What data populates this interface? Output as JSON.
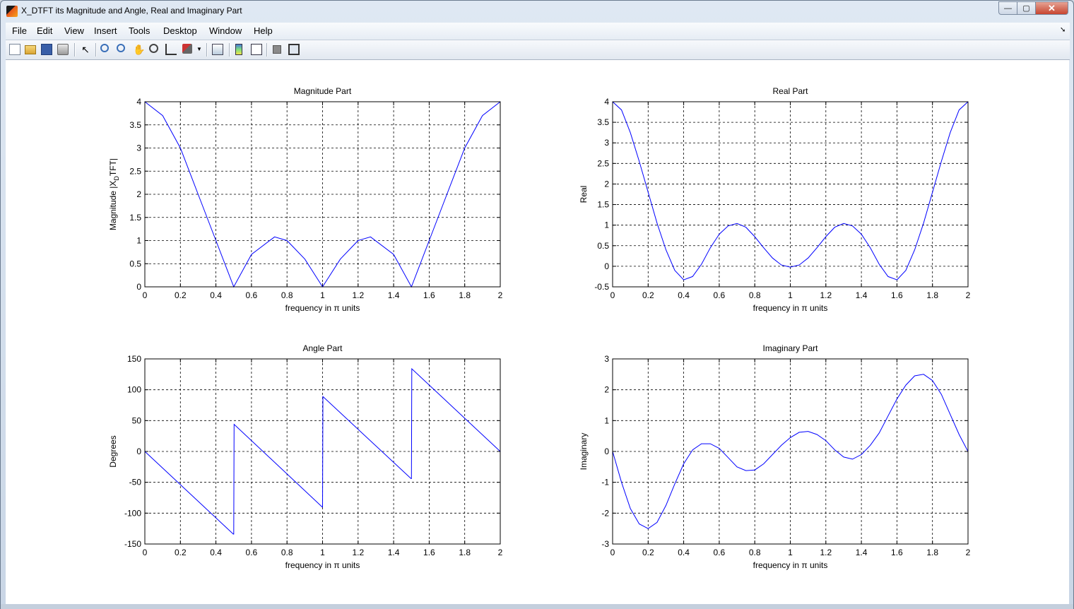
{
  "window": {
    "title": "X_DTFT its Magnitude and Angle, Real and Imaginary Part",
    "controls": {
      "minimize": "—",
      "maximize": "▢",
      "close": "✕"
    }
  },
  "menu": [
    "File",
    "Edit",
    "View",
    "Insert",
    "Tools",
    "Desktop",
    "Window",
    "Help"
  ],
  "menu_overflow": "➘",
  "toolbar_icons": [
    "new-figure-icon",
    "open-file-icon",
    "save-icon",
    "print-icon",
    "edit-plot-arrow-icon",
    "zoom-in-icon",
    "zoom-out-icon",
    "pan-hand-icon",
    "rotate-3d-icon",
    "data-cursor-icon",
    "brush-icon",
    "brush-dropdown-icon",
    "link-plot-icon",
    "colorbar-icon",
    "legend-icon",
    "hide-plot-tools-icon",
    "show-plot-tools-icon"
  ],
  "colors": {
    "line": "#0000ff",
    "grid": "#000000"
  },
  "chart_data": [
    {
      "type": "line",
      "title": "Magnitude Part",
      "xlabel": "frequency in π units",
      "ylabel_main": "Magnitude  |X",
      "ylabel_sub": "D",
      "ylabel_tail": "TFT|",
      "xlim": [
        0,
        2
      ],
      "ylim": [
        0,
        4
      ],
      "xticks": [
        "0",
        "0.2",
        "0.4",
        "0.6",
        "0.8",
        "1",
        "1.2",
        "1.4",
        "1.6",
        "1.8",
        "2"
      ],
      "yticks": [
        "0",
        "0.5",
        "1",
        "1.5",
        "2",
        "2.5",
        "3",
        "3.5",
        "4"
      ],
      "grid": true,
      "x": [
        0,
        0.1,
        0.2,
        0.3,
        0.4,
        0.5,
        0.6,
        0.73,
        0.8,
        0.9,
        1.0,
        1.1,
        1.2,
        1.27,
        1.4,
        1.5,
        1.6,
        1.7,
        1.8,
        1.9,
        2.0
      ],
      "y": [
        4,
        3.7,
        3.0,
        2.0,
        1.0,
        0,
        0.7,
        1.08,
        1.0,
        0.6,
        0,
        0.6,
        1.0,
        1.08,
        0.7,
        0,
        1.0,
        2.0,
        3.0,
        3.7,
        4
      ]
    },
    {
      "type": "line",
      "title": "Real Part",
      "xlabel": "frequency in π units",
      "ylabel": "Real",
      "xlim": [
        0,
        2
      ],
      "ylim": [
        -0.5,
        4
      ],
      "xticks": [
        "0",
        "0.2",
        "0.4",
        "0.6",
        "0.8",
        "1",
        "1.2",
        "1.4",
        "1.6",
        "1.8",
        "2"
      ],
      "yticks": [
        "-0.5",
        "0",
        "0.5",
        "1",
        "1.5",
        "2",
        "2.5",
        "3",
        "3.5",
        "4"
      ],
      "grid": true,
      "x": [
        0,
        0.05,
        0.1,
        0.15,
        0.2,
        0.25,
        0.3,
        0.35,
        0.4,
        0.45,
        0.5,
        0.55,
        0.6,
        0.65,
        0.7,
        0.75,
        0.8,
        0.85,
        0.9,
        0.95,
        1.0,
        1.05,
        1.1,
        1.15,
        1.2,
        1.25,
        1.3,
        1.35,
        1.4,
        1.45,
        1.5,
        1.55,
        1.6,
        1.65,
        1.7,
        1.75,
        1.8,
        1.85,
        1.9,
        1.95,
        2.0
      ],
      "y": [
        4,
        3.8,
        3.25,
        2.55,
        1.8,
        1.05,
        0.4,
        -0.1,
        -0.33,
        -0.25,
        0.05,
        0.45,
        0.78,
        0.98,
        1.04,
        0.95,
        0.72,
        0.45,
        0.2,
        0.03,
        -0.02,
        0.03,
        0.2,
        0.45,
        0.72,
        0.95,
        1.04,
        0.98,
        0.78,
        0.45,
        0.05,
        -0.25,
        -0.33,
        -0.1,
        0.4,
        1.05,
        1.8,
        2.55,
        3.25,
        3.8,
        4
      ]
    },
    {
      "type": "line",
      "title": "Angle Part",
      "xlabel": "frequency in π units",
      "ylabel": "Degrees",
      "xlim": [
        0,
        2
      ],
      "ylim": [
        -150,
        150
      ],
      "xticks": [
        "0",
        "0.2",
        "0.4",
        "0.6",
        "0.8",
        "1",
        "1.2",
        "1.4",
        "1.6",
        "1.8",
        "2"
      ],
      "yticks": [
        "-150",
        "-100",
        "-50",
        "0",
        "50",
        "100",
        "150"
      ],
      "grid": true,
      "x": [
        0,
        0.498,
        0.5,
        0.502,
        0.998,
        1.0,
        1.002,
        1.498,
        1.5,
        1.502,
        2.0
      ],
      "y": [
        0,
        -134,
        -134,
        44,
        -90,
        -90,
        89,
        -44,
        -44,
        134,
        0
      ]
    },
    {
      "type": "line",
      "title": "Imaginary Part",
      "xlabel": "frequency in π units",
      "ylabel": "Imaginary",
      "xlim": [
        0,
        2
      ],
      "ylim": [
        -3,
        3
      ],
      "xticks": [
        "0",
        "0.2",
        "0.4",
        "0.6",
        "0.8",
        "1",
        "1.2",
        "1.4",
        "1.6",
        "1.8",
        "2"
      ],
      "yticks": [
        "-3",
        "-2",
        "-1",
        "0",
        "1",
        "2",
        "3"
      ],
      "grid": true,
      "x": [
        0,
        0.05,
        0.1,
        0.15,
        0.2,
        0.25,
        0.3,
        0.35,
        0.4,
        0.45,
        0.5,
        0.55,
        0.6,
        0.65,
        0.7,
        0.75,
        0.8,
        0.85,
        0.9,
        0.95,
        1.0,
        1.05,
        1.1,
        1.15,
        1.2,
        1.25,
        1.3,
        1.35,
        1.4,
        1.45,
        1.5,
        1.55,
        1.6,
        1.65,
        1.7,
        1.75,
        1.8,
        1.85,
        1.9,
        1.95,
        2.0
      ],
      "y": [
        0,
        -1.0,
        -1.85,
        -2.35,
        -2.5,
        -2.3,
        -1.75,
        -1.05,
        -0.4,
        0.05,
        0.25,
        0.25,
        0.1,
        -0.2,
        -0.5,
        -0.62,
        -0.6,
        -0.4,
        -0.1,
        0.2,
        0.45,
        0.62,
        0.65,
        0.55,
        0.35,
        0.05,
        -0.18,
        -0.25,
        -0.1,
        0.2,
        0.6,
        1.15,
        1.7,
        2.15,
        2.45,
        2.5,
        2.3,
        1.85,
        1.2,
        0.55,
        0
      ]
    }
  ]
}
